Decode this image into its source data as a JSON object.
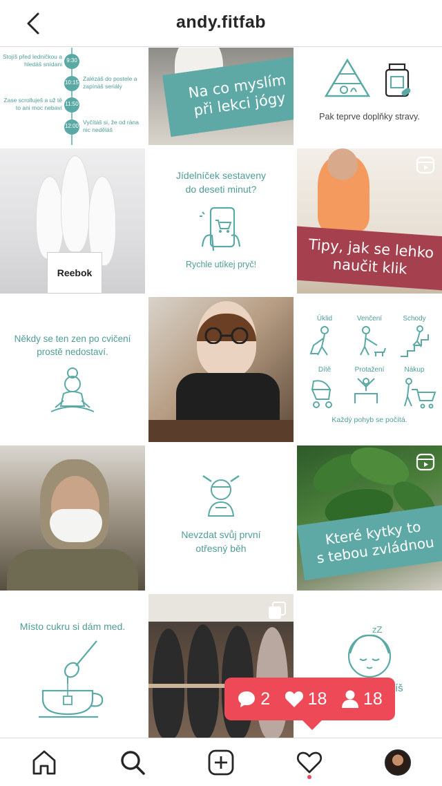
{
  "header": {
    "title": "andy.fitfab"
  },
  "posts": {
    "p1": {
      "lines": [
        {
          "time": "9:30",
          "text": "Stojíš před ledničkou a hledáš snídani"
        },
        {
          "time": "10:15",
          "text": "Zalézáš do postele a zapínáš seriály"
        },
        {
          "time": "11:50",
          "text": "Zase scrolluješ a už tě to ani moc nebaví"
        },
        {
          "time": "12:00",
          "text": "Vyčítáš si, že od rána nic neděláš"
        }
      ]
    },
    "p2": {
      "banner_line1": "Na co myslím",
      "banner_line2": "při lekci jógy"
    },
    "p3": {
      "caption": "Pak teprve doplňky stravy."
    },
    "p4": {
      "box_text": "Reebok"
    },
    "p5": {
      "line1": "Jídelníček sestaveny",
      "line2": "do deseti minut?",
      "footer": "Rychle utíkej pryč!"
    },
    "p6": {
      "banner_line1": "Tipy, jak se lehko",
      "banner_line2": "naučit klik"
    },
    "p7": {
      "line1": "Někdy se ten zen po cvičení",
      "line2": "prostě nedostaví."
    },
    "p9": {
      "items": [
        "Úklid",
        "Venčení",
        "Schody",
        "Dítě",
        "Protažení",
        "Nákup"
      ],
      "footer": "Každý pohyb se počítá."
    },
    "p11": {
      "line1": "Nevzdat svůj první",
      "line2": "otřesný běh"
    },
    "p12": {
      "banner_line1": "Které kytky to",
      "banner_line2": "s tebou zvládnou"
    },
    "p13": {
      "caption": "Místo cukru si dám med."
    },
    "p15": {
      "partial_text": "íš"
    }
  },
  "activity": {
    "comments": "2",
    "likes": "18",
    "follows": "18"
  },
  "colors": {
    "teal": "#5aa9a4",
    "banner_teal": "#5ea9a5",
    "banner_red": "#a5404e",
    "badge": "#ed4956"
  }
}
